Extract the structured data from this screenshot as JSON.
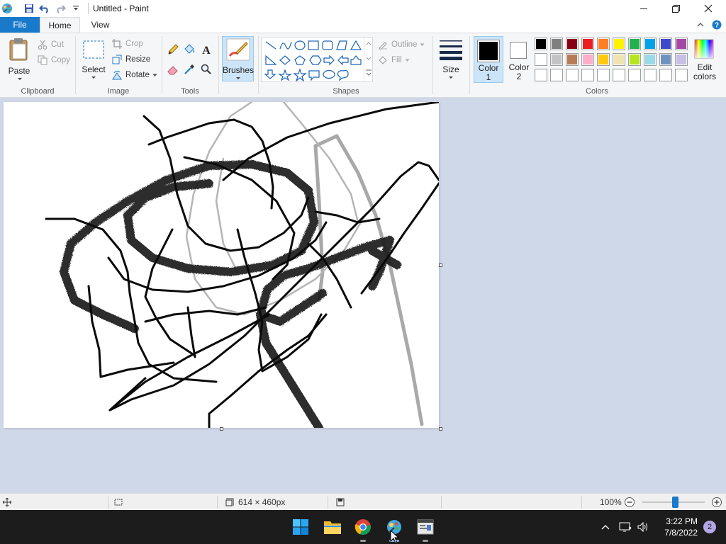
{
  "window": {
    "title": "Untitled - Paint"
  },
  "tabs": {
    "file": "File",
    "home": "Home",
    "view": "View"
  },
  "ribbon": {
    "clipboard": {
      "label": "Clipboard",
      "paste": "Paste",
      "cut": "Cut",
      "copy": "Copy"
    },
    "image": {
      "label": "Image",
      "select": "Select",
      "crop": "Crop",
      "resize": "Resize",
      "rotate": "Rotate"
    },
    "tools": {
      "label": "Tools"
    },
    "brushes": {
      "label": "Brushes"
    },
    "shapes": {
      "label": "Shapes",
      "outline": "Outline",
      "fill": "Fill"
    },
    "size": {
      "label": "Size"
    },
    "colors": {
      "label": "Colors",
      "color1_line1": "Color",
      "color1_line2": "1",
      "color2_line1": "Color",
      "color2_line2": "2",
      "edit_line1": "Edit",
      "edit_line2": "colors",
      "color1_value": "#000000",
      "color2_value": "#ffffff",
      "palette_row1": [
        "#000000",
        "#7f7f7f",
        "#880015",
        "#ed1c24",
        "#ff7f27",
        "#fff200",
        "#22b14c",
        "#00a2e8",
        "#3f48cc",
        "#a349a4"
      ],
      "palette_row2": [
        "#ffffff",
        "#c3c3c3",
        "#b97a57",
        "#ffaec9",
        "#ffc90e",
        "#efe4b0",
        "#b5e61d",
        "#99d9ea",
        "#7092be",
        "#c8bfe7"
      ],
      "palette_row3": [
        "#ffffff",
        "#ffffff",
        "#ffffff",
        "#ffffff",
        "#ffffff",
        "#ffffff",
        "#ffffff",
        "#ffffff",
        "#ffffff",
        "#ffffff"
      ]
    }
  },
  "status": {
    "canvas_size": "614 × 460px",
    "zoom": "100%",
    "zoom_fraction": 0.52
  },
  "taskbar": {
    "time": "3:22 PM",
    "date": "7/8/2022",
    "notifications": "2"
  }
}
